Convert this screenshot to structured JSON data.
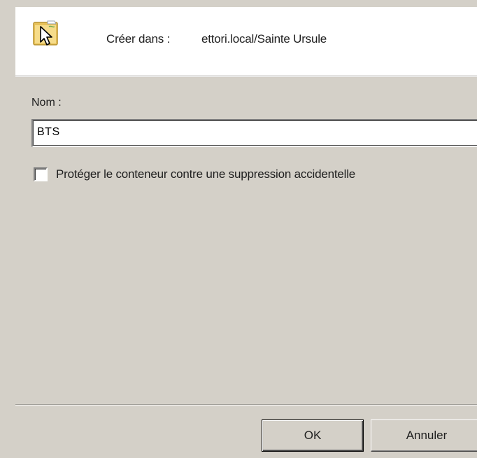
{
  "header": {
    "icon": "folder-cursor-icon",
    "create_in_label": "Créer dans :",
    "create_in_value": "ettori.local/Sainte Ursule"
  },
  "form": {
    "name_label": "Nom :",
    "name_value": "BTS",
    "protect_checkbox_label": "Protéger le conteneur contre une suppression accidentelle",
    "protect_checked": false
  },
  "buttons": {
    "ok_label": "OK",
    "cancel_label": "Annuler"
  },
  "colors": {
    "dialog_background": "#d4d0c8",
    "header_background": "#ffffff",
    "folder_yellow": "#f0c84a"
  }
}
